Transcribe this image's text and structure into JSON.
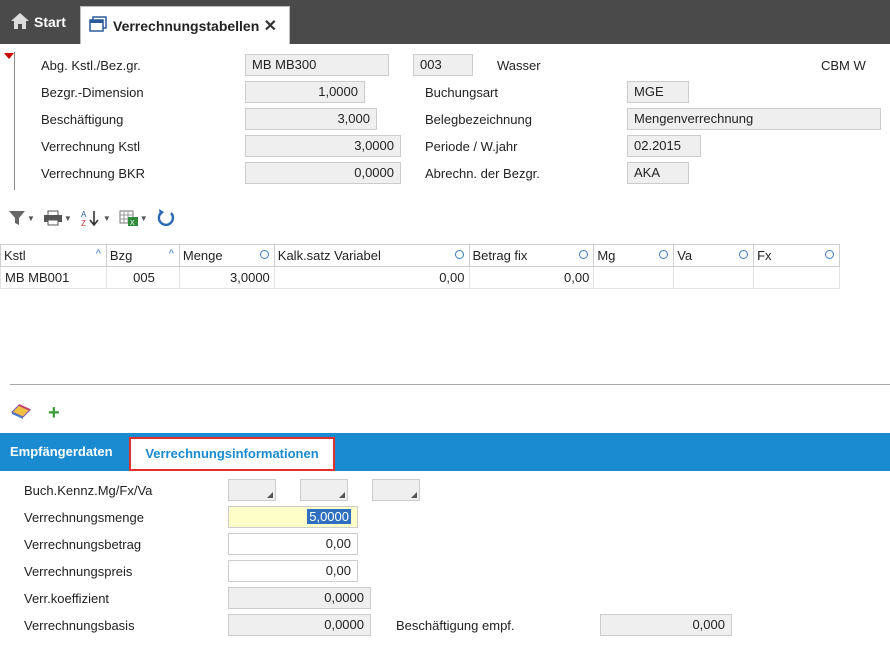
{
  "tabs": {
    "start": "Start",
    "active": "Verrechnungstabellen"
  },
  "header": {
    "abg_label": "Abg. Kstl./Bez.gr.",
    "abg_value": "MB MB300",
    "code_value": "003",
    "code_desc": "Wasser",
    "unit": "CBM W",
    "bezgr_dim_label": "Bezgr.-Dimension",
    "bezgr_dim_value": "1,0000",
    "buchungsart_label": "Buchungsart",
    "buchungsart_value": "MGE",
    "beschaeftigung_label": "Beschäftigung",
    "beschaeftigung_value": "3,000",
    "belegbez_label": "Belegbezeichnung",
    "belegbez_value": "Mengenverrechnung",
    "verr_kstl_label": "Verrechnung Kstl",
    "verr_kstl_value": "3,0000",
    "periode_label": "Periode / W.jahr",
    "periode_value": "02.2015",
    "verr_bkr_label": "Verrechnung BKR",
    "verr_bkr_value": "0,0000",
    "abrechn_label": "Abrechn. der Bezgr.",
    "abrechn_value": "AKA"
  },
  "grid": {
    "columns": [
      "Kstl",
      "Bzg",
      "Menge",
      "Kalk.satz Variabel",
      "Betrag fix",
      "Mg",
      "Va",
      "Fx"
    ],
    "rows": [
      {
        "kstl": "MB MB001",
        "bzg": "005",
        "menge": "3,0000",
        "kalk": "0,00",
        "betrag": "0,00",
        "mg": "",
        "va": "",
        "fx": ""
      }
    ]
  },
  "bottom_tabs": {
    "tab1": "Empfängerdaten",
    "tab2": "Verrechnungsinformationen"
  },
  "details": {
    "buch_label": "Buch.Kennz.Mg/Fx/Va",
    "menge_label": "Verrechnungsmenge",
    "menge_value": "5,0000",
    "betrag_label": "Verrechnungsbetrag",
    "betrag_value": "0,00",
    "preis_label": "Verrechnungspreis",
    "preis_value": "0,00",
    "koeff_label": "Verr.koeffizient",
    "koeff_value": "0,0000",
    "basis_label": "Verrechnungsbasis",
    "basis_value": "0,0000",
    "besch_label": "Beschäftigung empf.",
    "besch_value": "0,000"
  },
  "colors": {
    "accent": "#1a8bd0",
    "highlight_border": "#e03030",
    "topbar": "#4a4a4a"
  }
}
